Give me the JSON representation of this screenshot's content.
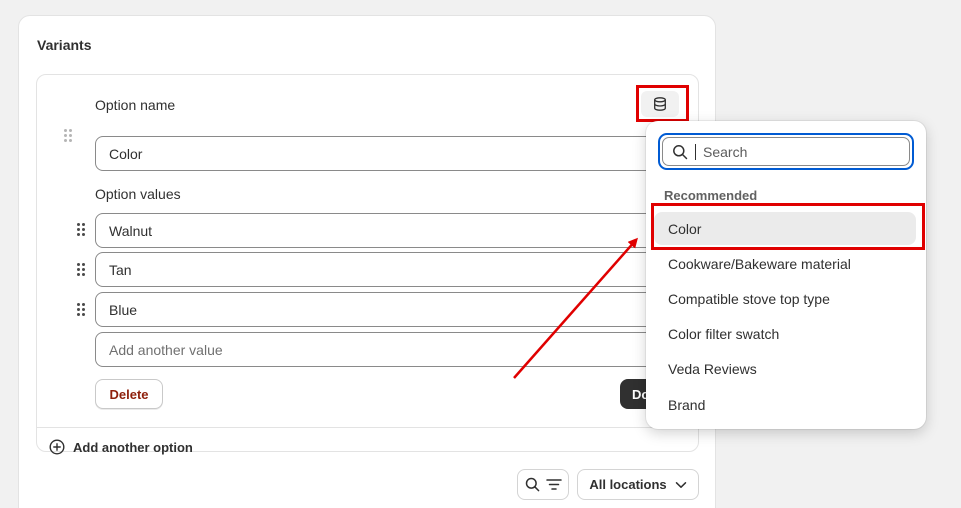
{
  "card": {
    "title": "Variants"
  },
  "option": {
    "name_label": "Option name",
    "name_value": "Color",
    "values_label": "Option values",
    "values": [
      "Walnut",
      "Tan",
      "Blue"
    ],
    "add_value_placeholder": "Add another value",
    "delete_label": "Delete",
    "done_label": "Do"
  },
  "add_option_label": "Add another option",
  "toolbar": {
    "locations_label": "All locations"
  },
  "popover": {
    "search_placeholder": "Search",
    "section_heading": "Recommended",
    "items": [
      "Color",
      "Cookware/Bakeware material",
      "Compatible stove top type",
      "Color filter swatch",
      "Veda Reviews",
      "Brand"
    ]
  },
  "colors": {
    "highlight": "#e00000",
    "focus_ring": "#005bd3",
    "delete_text": "#8e1f0b",
    "primary_button": "#303030"
  },
  "icons": {
    "metafield": "database-icon",
    "search": "search-icon",
    "filter": "filter-icon",
    "add": "plus-circle-icon",
    "chevron": "chevron-down-icon",
    "drag": "drag-handle-icon"
  }
}
